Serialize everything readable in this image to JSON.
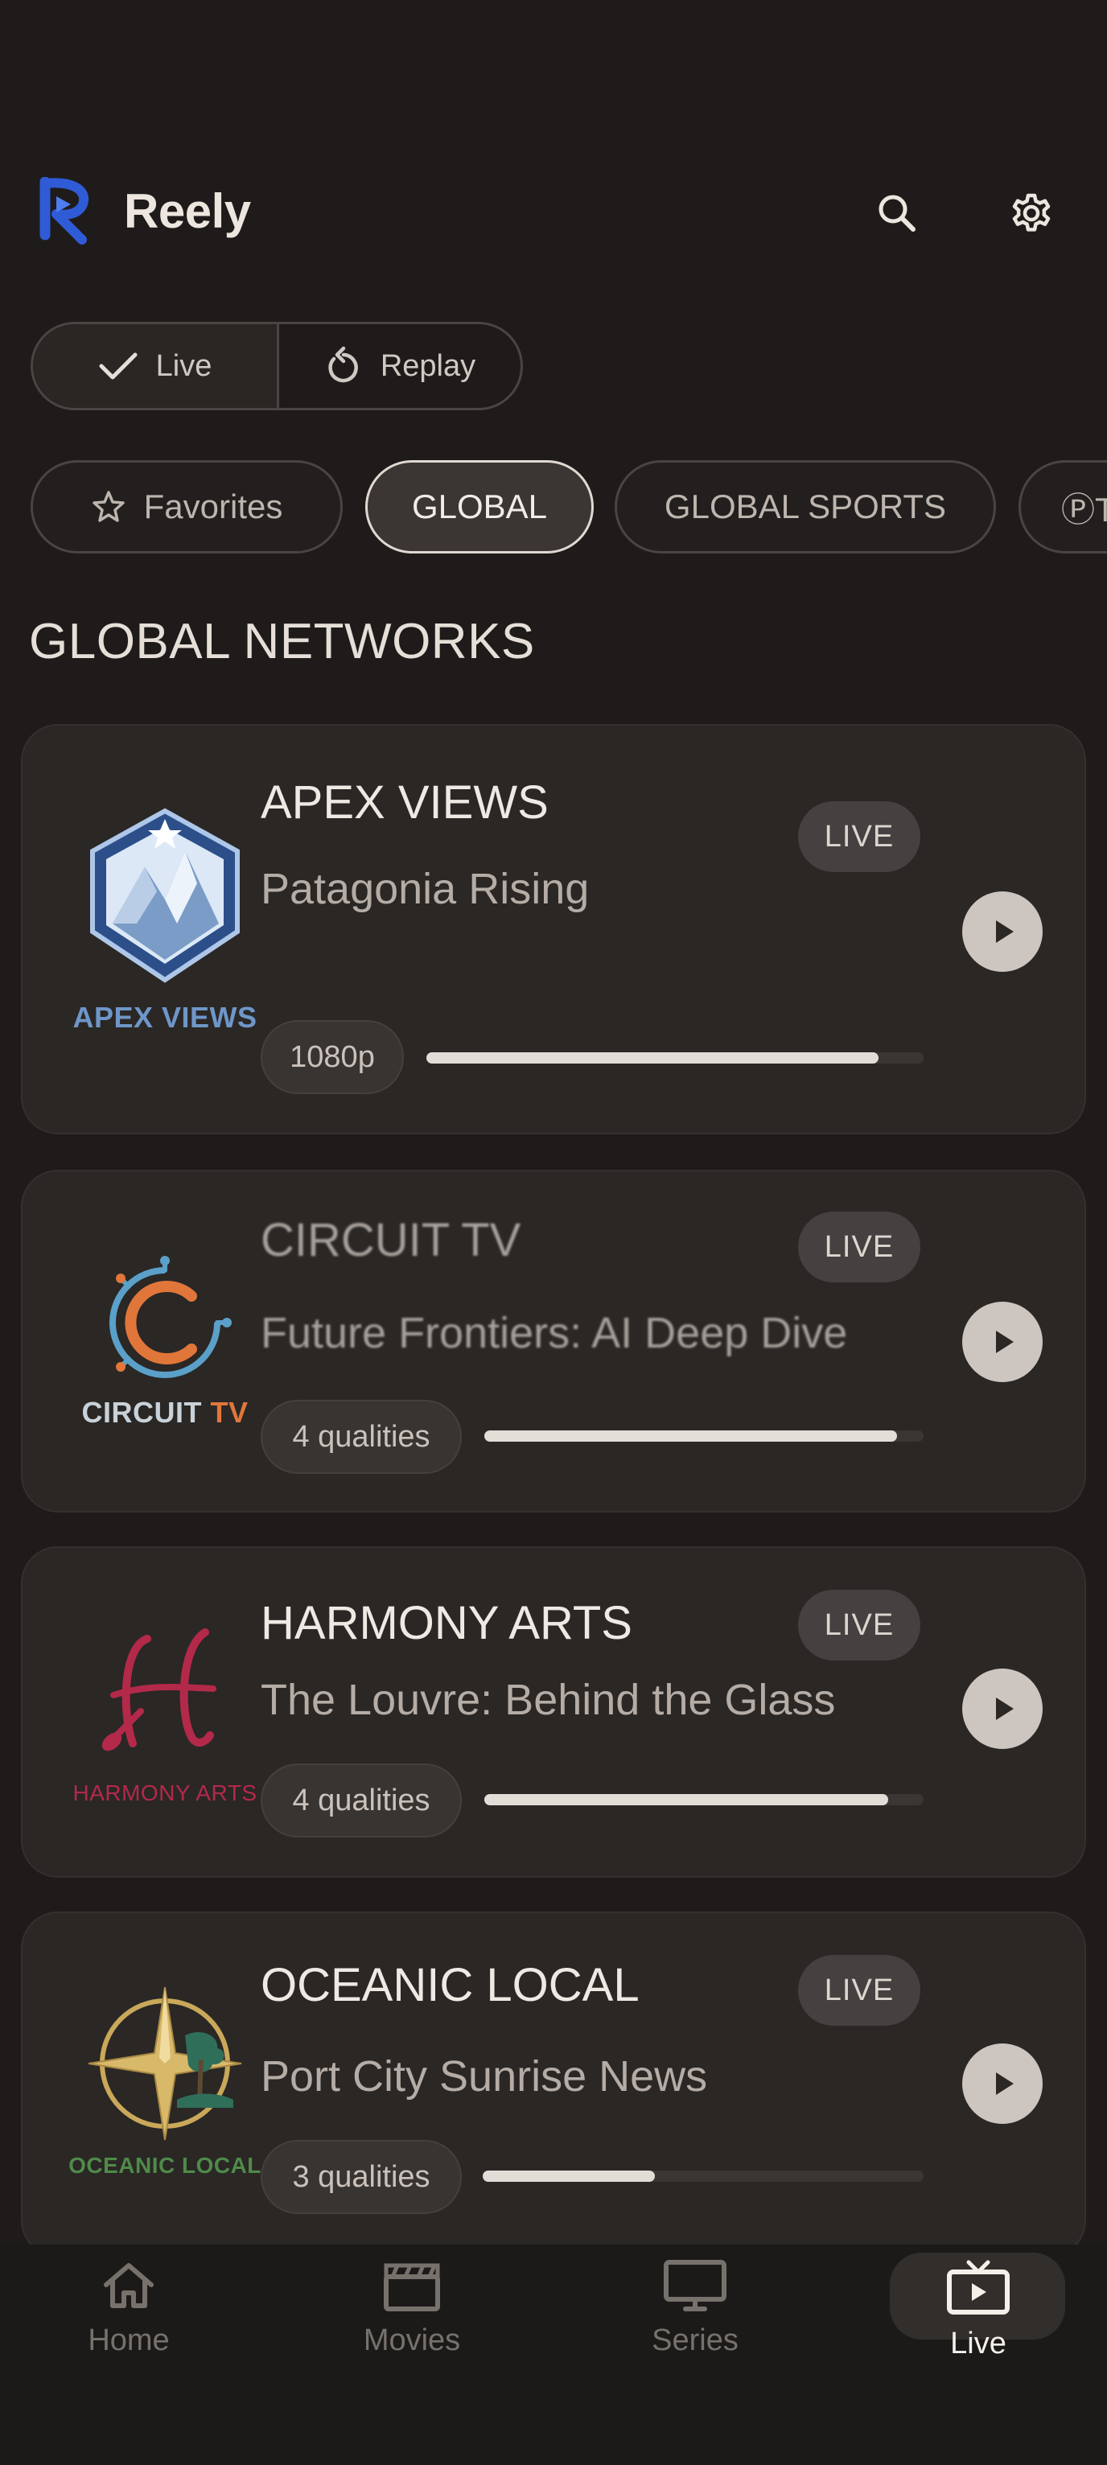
{
  "app": {
    "title": "Reely"
  },
  "header": {
    "search_icon": "search-icon",
    "settings_icon": "gear-icon"
  },
  "mode_toggle": {
    "options": [
      {
        "label": "Live",
        "icon": "check-icon",
        "selected": true
      },
      {
        "label": "Replay",
        "icon": "replay-icon",
        "selected": false
      }
    ]
  },
  "categories": [
    {
      "label": "Favorites",
      "icon": "star-icon",
      "active": false
    },
    {
      "label": "GLOBAL",
      "active": true
    },
    {
      "label": "GLOBAL SPORTS",
      "active": false
    },
    {
      "label": "ⓅT",
      "active": false
    }
  ],
  "section": {
    "title": "GLOBAL NETWORKS"
  },
  "channels": [
    {
      "name": "APEX VIEWS",
      "program": "Patagonia Rising",
      "badge": "LIVE",
      "quality": "1080p",
      "progress": 0.91,
      "logo_text": "APEX VIEWS",
      "logo_color": "#6f96c8"
    },
    {
      "name": "CIRCUIT TV",
      "program": "Future Frontiers: AI Deep Dive",
      "badge": "LIVE",
      "quality": "4 qualities",
      "progress": 0.94,
      "logo_text_a": "CIRCUIT",
      "logo_text_b": "TV",
      "logo_color_a": "#c9d2d8",
      "logo_color_b": "#e0763a"
    },
    {
      "name": "HARMONY ARTS",
      "program": "The Louvre: Behind the Glass",
      "badge": "LIVE",
      "quality": "4 qualities",
      "progress": 0.92,
      "logo_text": "HARMONY ARTS",
      "logo_color": "#b3294a"
    },
    {
      "name": "OCEANIC LOCAL",
      "program": "Port City Sunrise News",
      "badge": "LIVE",
      "quality": "3 qualities",
      "progress": 0.39,
      "logo_text": "OCEANIC LOCAL",
      "logo_color": "#4f8a49"
    }
  ],
  "nav": {
    "items": [
      {
        "label": "Home",
        "icon": "home-icon",
        "active": false
      },
      {
        "label": "Movies",
        "icon": "clapperboard-icon",
        "active": false
      },
      {
        "label": "Series",
        "icon": "monitor-icon",
        "active": false
      },
      {
        "label": "Live",
        "icon": "live-tv-icon",
        "active": true
      }
    ]
  },
  "colors": {
    "background": "#1e1b1a",
    "card": "#2a2725",
    "accent_logo": "#2f5bd6"
  }
}
